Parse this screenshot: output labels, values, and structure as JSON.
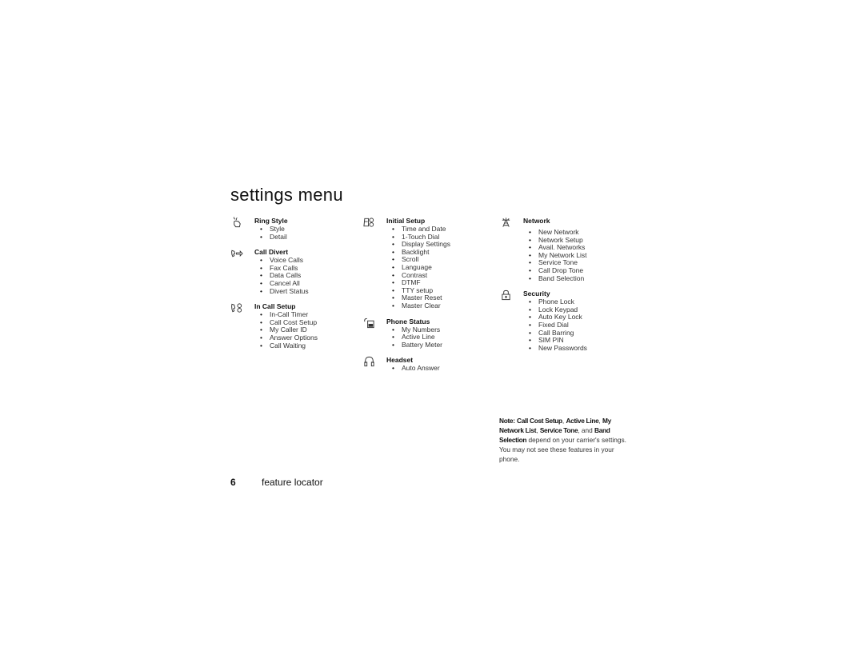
{
  "page": {
    "title": "settings menu",
    "page_number": "6",
    "section_label": "feature locator"
  },
  "columns": [
    {
      "groups": [
        {
          "icon": "ring-style-icon",
          "heading": "Ring Style",
          "items": [
            "Style",
            "Detail"
          ]
        },
        {
          "icon": "call-divert-icon",
          "heading": "Call Divert",
          "items": [
            "Voice Calls",
            "Fax Calls",
            "Data Calls",
            "Cancel All",
            "Divert Status"
          ]
        },
        {
          "icon": "in-call-setup-icon",
          "heading": "In Call Setup",
          "items": [
            "In-Call Timer",
            "Call Cost Setup",
            "My Caller ID",
            "Answer Options",
            "Call Waiting"
          ]
        }
      ]
    },
    {
      "groups": [
        {
          "icon": "initial-setup-icon",
          "heading": "Initial Setup",
          "items": [
            "Time and Date",
            "1-Touch Dial",
            "Display Settings",
            "Backlight",
            "Scroll",
            "Language",
            "Contrast",
            "DTMF",
            "TTY setup",
            "Master Reset",
            "Master Clear"
          ]
        },
        {
          "icon": "phone-status-icon",
          "heading": "Phone Status",
          "items": [
            "My Numbers",
            "Active Line",
            "Battery Meter"
          ]
        },
        {
          "icon": "headset-icon",
          "heading": "Headset",
          "items": [
            "Auto Answer"
          ]
        }
      ]
    },
    {
      "groups": [
        {
          "icon": "network-icon",
          "heading": "Network",
          "items": [
            "New Network",
            "Network Setup",
            "Avail. Networks",
            "My Network List",
            "Service Tone",
            "Call Drop Tone",
            "Band Selection"
          ]
        },
        {
          "icon": "security-icon",
          "heading": "Security",
          "items": [
            "Phone Lock",
            "Lock Keypad",
            "Auto Key Lock",
            "Fixed Dial",
            "Call Barring",
            "SIM PIN",
            "New Passwords"
          ]
        }
      ]
    }
  ],
  "note": {
    "label": "Note:",
    "bold_terms": [
      "Call Cost Setup",
      "Active Line",
      "My Network List",
      "Service Tone",
      "Band Selection"
    ],
    "sep1": ", ",
    "sep2": ", ",
    "sep3": ", ",
    "sep4": ", and ",
    "text": " depend on your carrier's settings. You may not see these features in your phone."
  }
}
